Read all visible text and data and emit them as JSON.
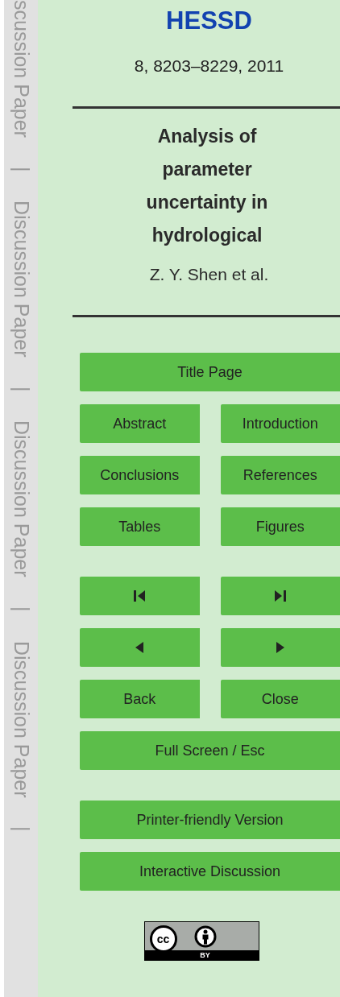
{
  "margin_strip": [
    "scussion Paper",
    "|",
    "Discussion Paper",
    "|",
    "Discussion Paper",
    "|",
    "Discussion Paper",
    "|"
  ],
  "journal": "HESSD",
  "citation": "8, 8203–8229, 2011",
  "title": "Analysis of parameter uncertainty in hydrological",
  "authors": "Z. Y. Shen et al.",
  "button_groups": [
    [
      [
        {
          "kind": "text",
          "label": "Title Page"
        }
      ],
      [
        {
          "kind": "text",
          "label": "Abstract"
        },
        {
          "kind": "text",
          "label": "Introduction"
        }
      ],
      [
        {
          "kind": "text",
          "label": "Conclusions"
        },
        {
          "kind": "text",
          "label": "References"
        }
      ],
      [
        {
          "kind": "text",
          "label": "Tables"
        },
        {
          "kind": "text",
          "label": "Figures"
        }
      ]
    ],
    [
      [
        {
          "kind": "first"
        },
        {
          "kind": "last"
        }
      ],
      [
        {
          "kind": "previous"
        },
        {
          "kind": "next"
        }
      ],
      [
        {
          "kind": "text",
          "label": "Back"
        },
        {
          "kind": "text",
          "label": "Close"
        }
      ],
      [
        {
          "kind": "text",
          "label": "Full Screen / Esc"
        }
      ]
    ],
    [
      [
        {
          "kind": "text",
          "label": "Printer-friendly Version"
        }
      ],
      [
        {
          "kind": "text",
          "label": "Interactive Discussion"
        }
      ]
    ]
  ],
  "license": {
    "mark": "cc",
    "label": "BY"
  }
}
